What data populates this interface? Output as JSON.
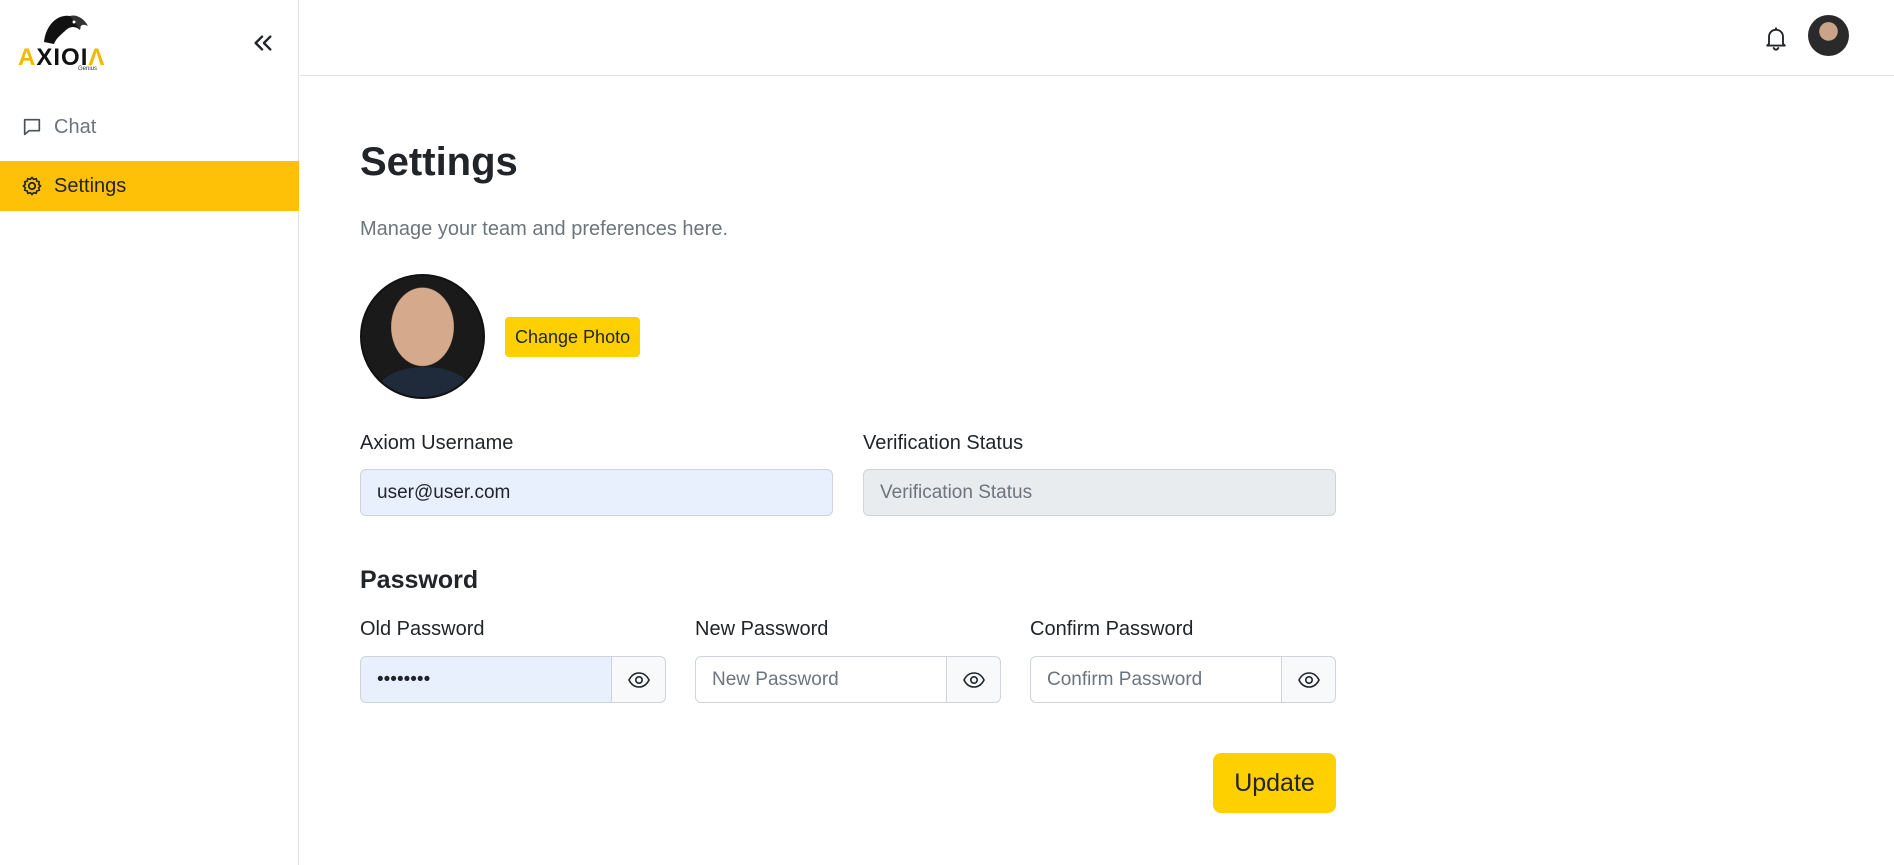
{
  "app": {
    "logo_text_left": "A",
    "logo_text_mid": "XIOI",
    "logo_text_right": "Λ",
    "logo_sub": "Genius"
  },
  "sidebar": {
    "items": [
      {
        "label": "Chat",
        "icon": "chat-bubble-icon",
        "active": false
      },
      {
        "label": "Settings",
        "icon": "gear-icon",
        "active": true
      }
    ]
  },
  "topbar": {
    "notification_icon": "bell-icon",
    "avatar_icon": "user-avatar"
  },
  "page": {
    "title": "Settings",
    "subtitle": "Manage your team and preferences here.",
    "change_photo_label": "Change Photo"
  },
  "form": {
    "username_label": "Axiom Username",
    "username_value": "user@user.com",
    "verification_label": "Verification Status",
    "verification_placeholder": "Verification Status",
    "password_heading": "Password",
    "old_password_label": "Old Password",
    "old_password_value": "••••••••",
    "new_password_label": "New Password",
    "new_password_placeholder": "New Password",
    "confirm_password_label": "Confirm Password",
    "confirm_password_placeholder": "Confirm Password",
    "update_label": "Update"
  },
  "colors": {
    "accent": "#ffc107",
    "button_yellow": "#ffd000",
    "autofill_bg": "#e8f0fe",
    "disabled_bg": "#e9ecef"
  }
}
